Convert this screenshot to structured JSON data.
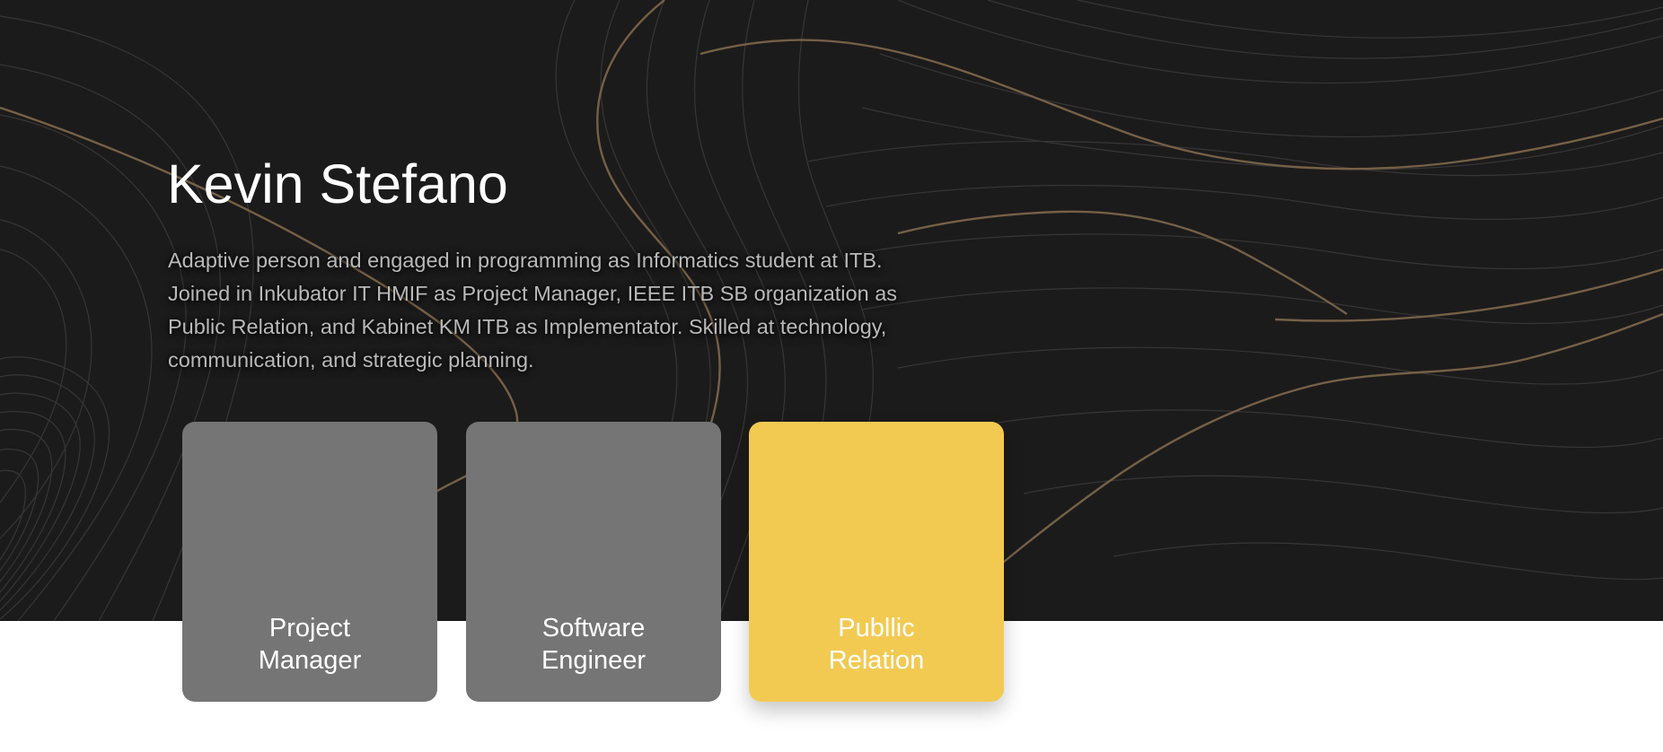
{
  "profile": {
    "name": "Kevin Stefano",
    "bio": "Adaptive person and engaged in programming as Informatics student at ITB. Joined in Inkubator IT HMIF as Project Manager, IEEE ITB SB organization as Public Relation, and Kabinet KM ITB as Implementator. Skilled at technology, communication, and strategic planning."
  },
  "roles": [
    {
      "label": "Project\nManager",
      "color": "#757575",
      "selected": false
    },
    {
      "label": "Software\nEngineer",
      "color": "#757575",
      "selected": false
    },
    {
      "label": "Publlic\nRelation",
      "color": "#f2ca52",
      "selected": true
    }
  ],
  "theme": {
    "hero_background": "#1c1b1b",
    "accent": "#f2ca52",
    "card_gray": "#757575",
    "topo_line_gold": "#7a6449",
    "topo_line_gray": "#3a3838"
  }
}
